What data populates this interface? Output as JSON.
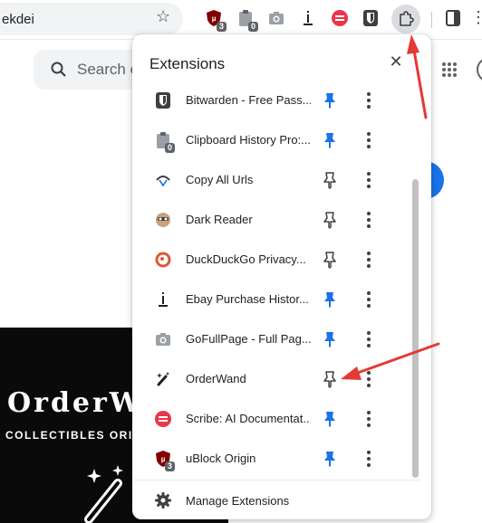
{
  "browser": {
    "omnibox_text": "ekdei",
    "star_icon": "star-icon",
    "toolbar_extensions": [
      {
        "name": "ublock-origin-icon",
        "badge": "3"
      },
      {
        "name": "clipboard-history-icon",
        "badge": "0"
      },
      {
        "name": "gofullpage-icon",
        "badge": ""
      },
      {
        "name": "ebay-purchase-history-icon",
        "badge": ""
      },
      {
        "name": "scribe-icon",
        "badge": ""
      },
      {
        "name": "bitwarden-icon",
        "badge": ""
      }
    ],
    "extensions_button_icon": "puzzle-icon"
  },
  "page": {
    "search_placeholder": "Search e",
    "promo_title": "OrderW",
    "promo_subtitle": "COLLECTIBLES ORI"
  },
  "popup": {
    "title": "Extensions",
    "close_icon": "close-icon",
    "items": [
      {
        "label": "Bitwarden - Free Pass...",
        "pinned": true,
        "icon": "bitwarden-icon"
      },
      {
        "label": "Clipboard History Pro:...",
        "pinned": true,
        "icon": "clipboard-history-icon",
        "badge": "0"
      },
      {
        "label": "Copy All Urls",
        "pinned": false,
        "icon": "copy-all-urls-icon"
      },
      {
        "label": "Dark Reader",
        "pinned": false,
        "icon": "dark-reader-icon"
      },
      {
        "label": "DuckDuckGo Privacy...",
        "pinned": false,
        "icon": "duckduckgo-icon"
      },
      {
        "label": "Ebay Purchase Histor...",
        "pinned": true,
        "icon": "ebay-purchase-history-icon"
      },
      {
        "label": "GoFullPage - Full Pag...",
        "pinned": true,
        "icon": "gofullpage-icon"
      },
      {
        "label": "OrderWand",
        "pinned": false,
        "icon": "orderwand-icon"
      },
      {
        "label": "Scribe: AI Documentat...",
        "pinned": true,
        "icon": "scribe-icon"
      },
      {
        "label": "uBlock Origin",
        "pinned": true,
        "icon": "ublock-origin-icon",
        "badge": "3"
      }
    ],
    "manage_label": "Manage Extensions"
  },
  "colors": {
    "pinned": "#1a73e8",
    "unpinned": "#3c4043",
    "annotation": "#e53935"
  }
}
